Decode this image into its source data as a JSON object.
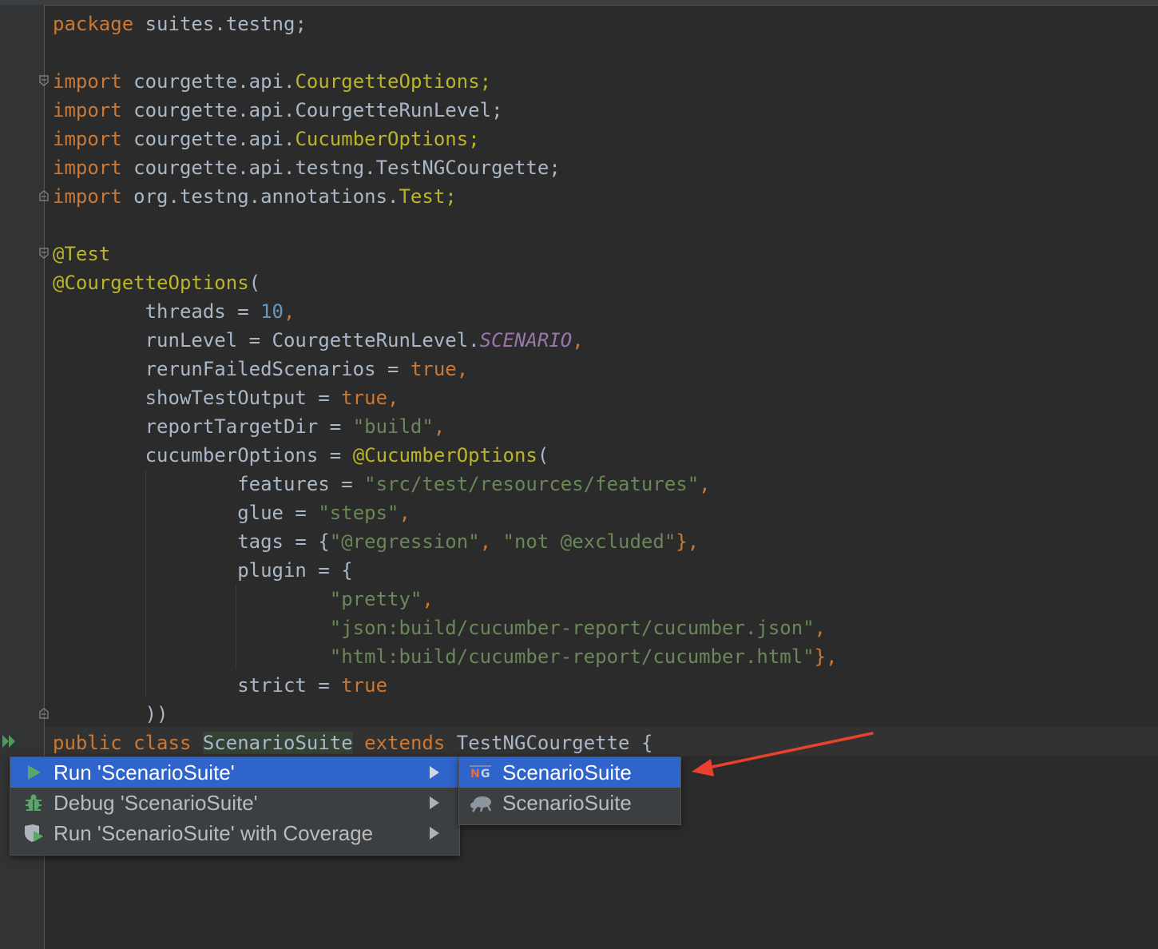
{
  "code": {
    "l1": {
      "kw": "package",
      "rest": " suites.testng;"
    },
    "l3": {
      "kw": "import",
      "pre": " courgette.api.",
      "ann": "CourgetteOptions",
      "post": ";"
    },
    "l4": {
      "kw": "import",
      "rest": " courgette.api.CourgetteRunLevel;"
    },
    "l5": {
      "kw": "import",
      "pre": " courgette.api.",
      "ann": "CucumberOptions",
      "post": ";"
    },
    "l6": {
      "kw": "import",
      "rest": " courgette.api.testng.TestNGCourgette;"
    },
    "l7": {
      "kw": "import",
      "pre": " org.testng.annotations.",
      "ann": "Test",
      "post": ";"
    },
    "l9": {
      "ann": "@Test"
    },
    "l10": {
      "ann": "@CourgetteOptions",
      "post": "("
    },
    "l11": {
      "pre": "        threads = ",
      "num": "10",
      "post": ","
    },
    "l12": {
      "pre": "        runLevel = CourgetteRunLevel.",
      "enum": "SCENARIO",
      "post": ","
    },
    "l13": {
      "pre": "        rerunFailedScenarios = ",
      "kw": "true",
      "post": ","
    },
    "l14": {
      "pre": "        showTestOutput = ",
      "kw": "true",
      "post": ","
    },
    "l15": {
      "pre": "        reportTargetDir = ",
      "str": "\"build\"",
      "post": ","
    },
    "l16": {
      "pre": "        cucumberOptions = ",
      "ann": "@CucumberOptions",
      "post": "("
    },
    "l17": {
      "pre": "                features = ",
      "str": "\"src/test/resources/features\"",
      "post": ","
    },
    "l18": {
      "pre": "                glue = ",
      "str": "\"steps\"",
      "post": ","
    },
    "l19": {
      "pre": "                tags = {",
      "str1": "\"@regression\"",
      "mid": ", ",
      "str2": "\"not @excluded\"",
      "post": "},"
    },
    "l20": {
      "pre": "                plugin = {"
    },
    "l21": {
      "pre": "                        ",
      "str": "\"pretty\"",
      "post": ","
    },
    "l22": {
      "pre": "                        ",
      "str": "\"json:build/cucumber-report/cucumber.json\"",
      "post": ","
    },
    "l23": {
      "pre": "                        ",
      "str": "\"html:build/cucumber-report/cucumber.html\"",
      "post": "},"
    },
    "l24": {
      "pre": "                strict = ",
      "kw": "true"
    },
    "l25": {
      "pre": "        ))"
    },
    "l26": {
      "kw1": "public",
      "sp1": " ",
      "kw2": "class",
      "sp2": " ",
      "name": "ScenarioSuite",
      "sp3": " ",
      "kw3": "extends",
      "post": " TestNGCourgette {"
    }
  },
  "context_menu": {
    "items": [
      {
        "label": "Run 'ScenarioSuite'",
        "icon": "run-icon",
        "selected": true
      },
      {
        "label": "Debug 'ScenarioSuite'",
        "icon": "debug-icon"
      },
      {
        "label": "Run 'ScenarioSuite' with Coverage",
        "icon": "coverage-icon"
      }
    ]
  },
  "submenu": {
    "items": [
      {
        "label": "ScenarioSuite",
        "icon": "testng-icon",
        "selected": true
      },
      {
        "label": "ScenarioSuite",
        "icon": "cucumber-icon"
      }
    ]
  },
  "colors": {
    "background": "#2b2b2b",
    "keyword": "#cc7832",
    "annotation": "#bbb529",
    "string": "#6a8759",
    "number": "#6897bb",
    "selection": "#2f65ca",
    "arrow": "#e8412c"
  }
}
